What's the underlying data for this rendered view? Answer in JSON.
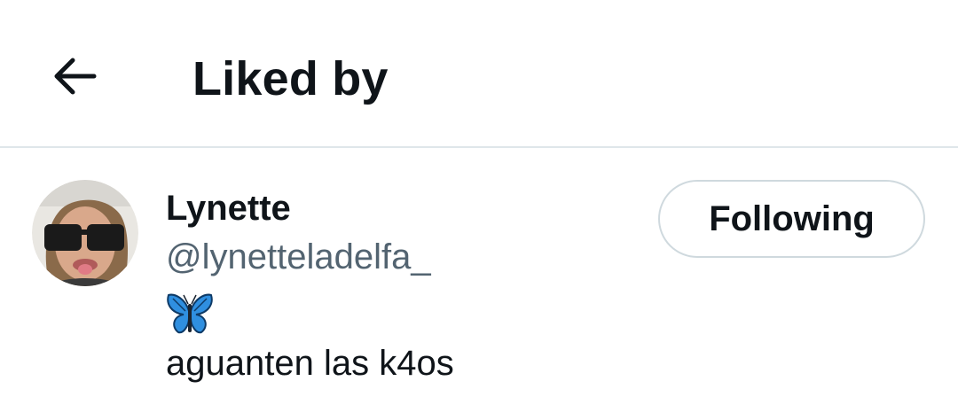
{
  "header": {
    "back_icon": "arrow-left-icon",
    "title": "Liked by"
  },
  "users": [
    {
      "display_name": "Lynette",
      "handle": "@lynetteladelfa_",
      "bio_emoji_icon": "butterfly-icon",
      "bio_text": "aguanten las k4os",
      "follow_label": "Following"
    }
  ],
  "colors": {
    "text_primary": "#0f1419",
    "text_secondary": "#536471",
    "divider": "#dfe6ea",
    "button_border": "#cfd9de",
    "butterfly": "#2f8fe0"
  }
}
